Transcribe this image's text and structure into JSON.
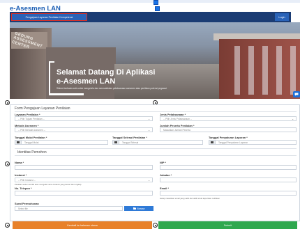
{
  "header": {
    "brand": "e-Asesmen LAN",
    "nav_request_label": "Pengajuan Layanan Penilaian Kompetensi",
    "nav_login_label": "Login"
  },
  "hero": {
    "building_sign": "GEDUNG ASSESSMENT CENTER",
    "title_line1": "Selamat Datang Di Aplikasi",
    "title_line2": "e-Asesmen LAN",
    "subtitle": "Sistem berbasis web untuk mengelola dan memudahkan pelaksanaan asesmen atau penilaian potensi pegawai."
  },
  "form": {
    "title": "Form Pengajuan Layanan Penilaian",
    "layanan_label": "Layanan Penilaian *",
    "layanan_placeholder": "-- Pilih Tujuan Penilaian --",
    "jenis_label": "Jenis Pelaksanaan *",
    "jenis_placeholder": "-- Pilih Jenis Pelaksanaan --",
    "metode_label": "Metode Asesmen *",
    "metode_placeholder": "-- Pilih Metode Asesmen --",
    "jumlah_label": "Jumlah Peserta Penilaian *",
    "jumlah_placeholder": "Masukkan Jumlah Peserta",
    "tgl_mulai_label": "Tanggal Mulai Penilaian *",
    "tgl_mulai_placeholder": "Tanggal Mulai",
    "tgl_selesai_label": "Tanggal Selesai Penilaian *",
    "tgl_selesai_placeholder": "Tanggal Selesai",
    "tgl_penyaluran_label": "Tanggal Penyaluran Laporan *",
    "tgl_penyaluran_placeholder": "Tanggal Penyaluran Laporan",
    "identitas_title": "Identitas Pemohon",
    "nama_label": "Nama *",
    "nip_label": "NIP *",
    "instansi_label": "Instansi *",
    "instansi_placeholder": "-- Pilih Instansi --",
    "instansi_note": "Pastikan anda memilih atau mengetik nama Instansi yang benar dan lengkap",
    "jabatan_label": "Jabatan *",
    "telepon_label": "No. Telepon *",
    "email_label": "Email *",
    "email_note": "Harap masukkan email yang valid dan aktif untuk keperluan notifikasi",
    "surat_label": "Surat Permohonan",
    "file_placeholder": "Select file",
    "browse_label": "Browse"
  },
  "actions": {
    "cancel_label": "Kembali ke halaman utama",
    "submit_label": "Submit"
  },
  "colors": {
    "brand_blue": "#1b5eb5",
    "nav_dark": "#1b3c74",
    "cancel_orange": "#e8812a",
    "submit_green": "#2fa84f"
  }
}
